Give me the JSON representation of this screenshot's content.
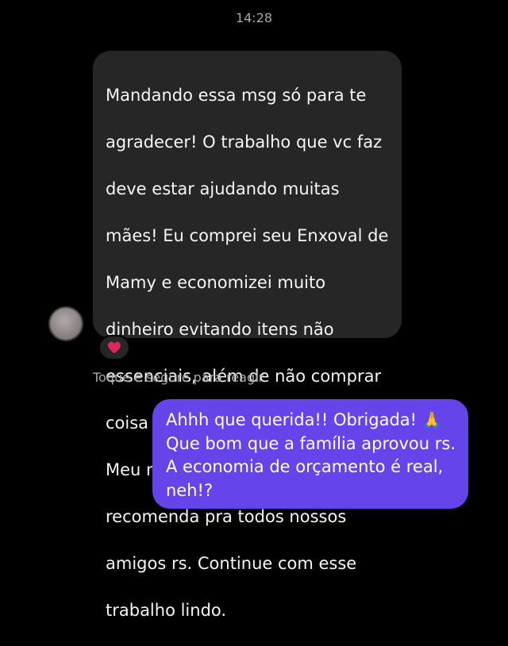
{
  "header": {
    "time": "14:28"
  },
  "incoming_message": {
    "lines": [
      "Mandando essa msg só para te",
      "agradecer! O trabalho que vc faz",
      "deve estar ajudando muitas",
      "mães! Eu comprei seu Enxoval de",
      "Mamy e economizei muito",
      "dinheiro evitando itens não",
      "essenciais, além de não comprar",
      "coisa em excesso!! Obrigada :)",
      "Meu marido virou fã e já",
      "recomenda pra todos nossos",
      "amigos rs. Continue com esse",
      "trabalho lindo."
    ],
    "reaction_icon": "red-heart",
    "avatar_icon": "blurred-profile-photo"
  },
  "hint_text": "Toque e segure para reagir",
  "outgoing_message": {
    "line1": "Ahhh que querida!! Obrigada!",
    "emoji": "🙏",
    "lines": [
      "Que bom que a família aprovou rs.",
      "A economia de orçamento é real,",
      "neh!?"
    ]
  },
  "colors": {
    "background": "#000000",
    "incoming_bubble": "#262626",
    "outgoing_bubble": "#6544ea",
    "heart": "#e0245e",
    "muted_text": "#a8a8a8"
  }
}
